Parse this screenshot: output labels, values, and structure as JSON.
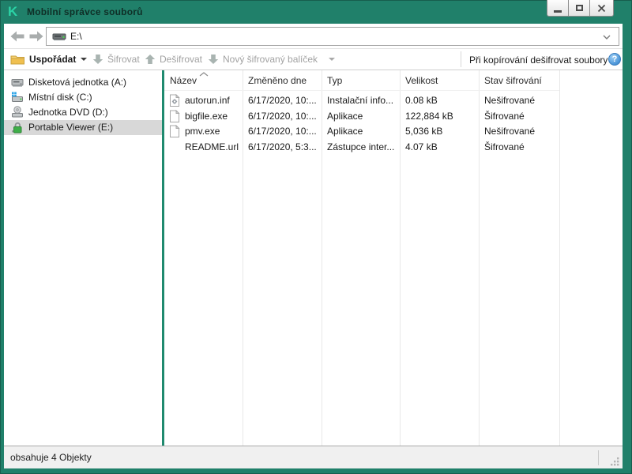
{
  "window": {
    "title": "Mobilní správce souborů",
    "logo_text": "K",
    "controls": {
      "minimize": "minimize",
      "maximize": "maximize",
      "close": "close"
    }
  },
  "colors": {
    "titlebar": "#20806A",
    "logo_accent": "#2BD3A6",
    "splitter": "#1F8A6F",
    "selection": "#D8D8D8",
    "statusbar_bg": "#F0F0F0",
    "help_blue": "#4A94D8",
    "lock_green": "#3FAE49"
  },
  "navbar": {
    "back_icon": "arrow-left-icon",
    "forward_icon": "arrow-right-icon",
    "address_icon": "drive-icon",
    "address_path": "E:\\"
  },
  "toolbar": {
    "organize_label": "Uspořádat",
    "organize_icon": "folder-icon",
    "encrypt_label": "Šifrovat",
    "encrypt_icon": "arrow-down-icon",
    "decrypt_label": "Dešifrovat",
    "decrypt_icon": "arrow-up-icon",
    "new_package_label": "Nový šifrovaný balíček",
    "new_package_icon": "arrow-down-icon",
    "decrypt_on_copy_label": "Při kopírování dešifrovat soubory",
    "help_icon": "help-icon"
  },
  "sidebar": {
    "items": [
      {
        "label": "Disketová jednotka (A:)",
        "icon": "floppy-drive-icon",
        "selected": false
      },
      {
        "label": "Místní disk (C:)",
        "icon": "hard-drive-icon",
        "selected": false
      },
      {
        "label": "Jednotka DVD (D:)",
        "icon": "dvd-drive-icon",
        "selected": false
      },
      {
        "label": "Portable Viewer (E:)",
        "icon": "encrypted-drive-icon",
        "selected": true
      }
    ]
  },
  "filelist": {
    "columns": [
      "Název",
      "Změněno dne",
      "Typ",
      "Velikost",
      "Stav šifrování"
    ],
    "sort": {
      "column": "Název",
      "direction": "asc"
    },
    "rows": [
      {
        "icon": "setup-info-file-icon",
        "name": "autorun.inf",
        "modified": "6/17/2020, 10:...",
        "type": "Instalační info...",
        "size": "0.08 kB",
        "encryption_status": "Nešifrované"
      },
      {
        "icon": "generic-file-icon",
        "name": "bigfile.exe",
        "modified": "6/17/2020, 10:...",
        "type": "Aplikace",
        "size": "122,884 kB",
        "encryption_status": "Šifrované"
      },
      {
        "icon": "generic-file-icon",
        "name": "pmv.exe",
        "modified": "6/17/2020, 10:...",
        "type": "Aplikace",
        "size": "5,036 kB",
        "encryption_status": "Nešifrované"
      },
      {
        "icon": "none",
        "name": "README.url",
        "modified": "6/17/2020, 5:3...",
        "type": "Zástupce inter...",
        "size": "4.07 kB",
        "encryption_status": "Šifrované"
      }
    ]
  },
  "statusbar": {
    "text": "obsahuje 4 Objekty"
  }
}
